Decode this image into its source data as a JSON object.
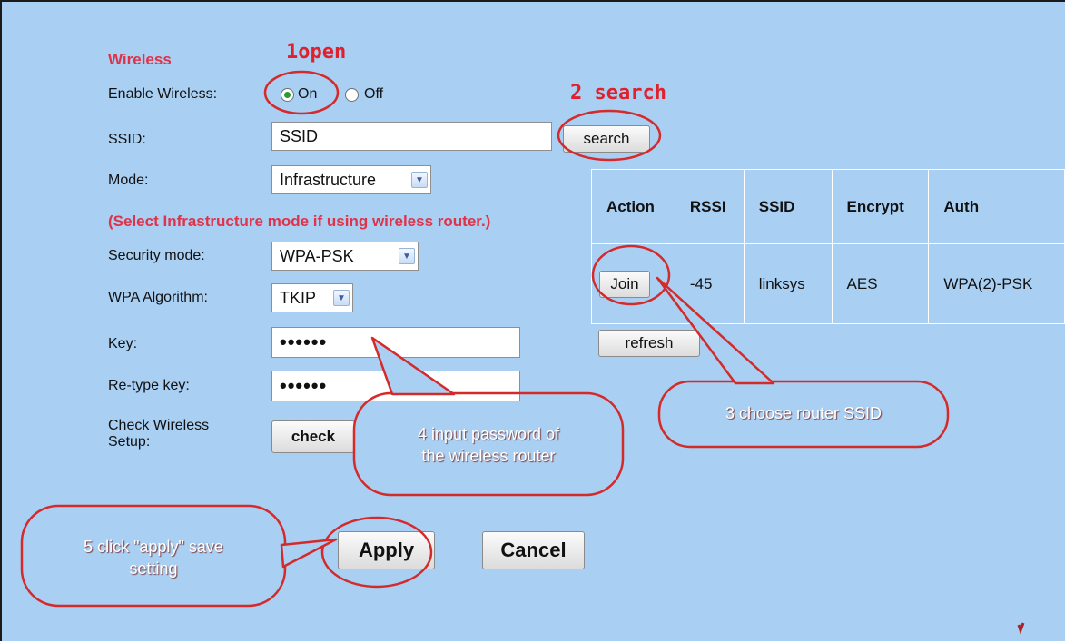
{
  "form": {
    "section_title": "Wireless",
    "enable_wireless_label": "Enable Wireless:",
    "radio_on": "On",
    "radio_off": "Off",
    "ssid_label": "SSID:",
    "ssid_value": "SSID",
    "search_button": "search",
    "mode_label": "Mode:",
    "mode_value": "Infrastructure",
    "mode_hint": "(Select Infrastructure mode if using wireless router.)",
    "security_label": "Security mode:",
    "security_value": "WPA-PSK",
    "algorithm_label": "WPA Algorithm:",
    "algorithm_value": "TKIP",
    "key_label": "Key:",
    "key_value": "••••••",
    "retype_label": "Re-type key:",
    "retype_value": "••••••",
    "check_label": "Check Wireless Setup:",
    "check_button": "check",
    "apply_button": "Apply",
    "cancel_button": "Cancel"
  },
  "scan_table": {
    "headers": [
      "Action",
      "RSSI",
      "SSID",
      "Encrypt",
      "Auth"
    ],
    "rows": [
      {
        "action": "Join",
        "rssi": "-45",
        "ssid": "linksys",
        "encrypt": "AES",
        "auth": "WPA(2)-PSK"
      }
    ],
    "refresh_button": "refresh"
  },
  "annotations": {
    "step1": "1open",
    "step2": "2  search",
    "step3": "3 choose router SSID",
    "step4_line1": "4 input password of",
    "step4_line2": "the wireless router",
    "step5_line1": "5  click \"apply\"  save",
    "step5_line2": "setting"
  },
  "colors": {
    "panel_bg": "#a9cff3",
    "accent_red": "#e0334a",
    "annotation_red": "#e0202a"
  }
}
